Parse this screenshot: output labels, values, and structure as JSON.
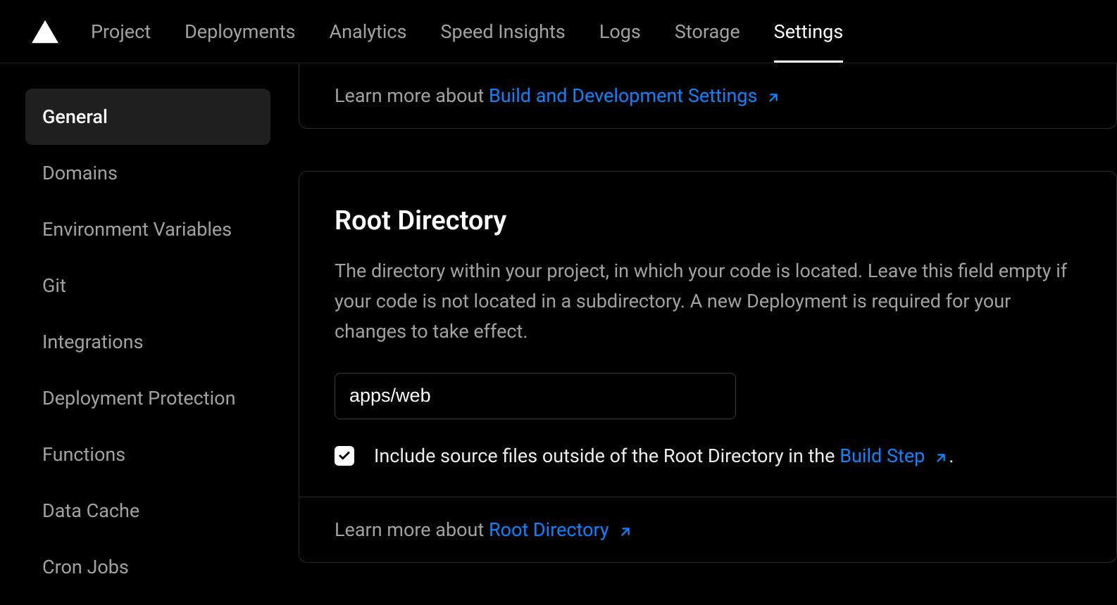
{
  "nav": {
    "tabs": [
      {
        "label": "Project"
      },
      {
        "label": "Deployments"
      },
      {
        "label": "Analytics"
      },
      {
        "label": "Speed Insights"
      },
      {
        "label": "Logs"
      },
      {
        "label": "Storage"
      },
      {
        "label": "Settings"
      }
    ]
  },
  "sidebar": {
    "items": [
      {
        "label": "General"
      },
      {
        "label": "Domains"
      },
      {
        "label": "Environment Variables"
      },
      {
        "label": "Git"
      },
      {
        "label": "Integrations"
      },
      {
        "label": "Deployment Protection"
      },
      {
        "label": "Functions"
      },
      {
        "label": "Data Cache"
      },
      {
        "label": "Cron Jobs"
      }
    ]
  },
  "card1": {
    "learn_prefix": "Learn more about ",
    "learn_link": "Build and Development Settings"
  },
  "card2": {
    "title": "Root Directory",
    "description": "The directory within your project, in which your code is located. Leave this field empty if your code is not located in a subdirectory. A new Deployment is required for your changes to take effect.",
    "input_value": "apps/web",
    "checkbox_label_prefix": "Include source files outside of the Root Directory in the ",
    "checkbox_link": "Build Step",
    "checkbox_label_suffix": ".",
    "learn_prefix": "Learn more about ",
    "learn_link": "Root Directory"
  }
}
